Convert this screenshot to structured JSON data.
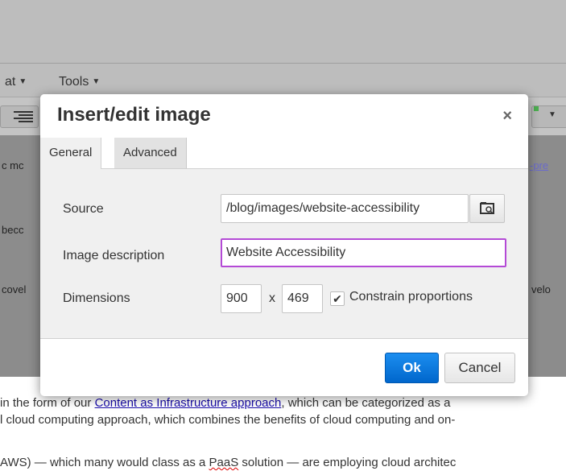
{
  "menubar": {
    "partial_menu": "at",
    "tools": "Tools"
  },
  "background": {
    "left_fragments": [
      "c mc",
      "becc",
      "covel"
    ],
    "right_link_fragment": "-pre",
    "right_fragment": "velo",
    "paragraph1_before": "in the form of our ",
    "paragraph1_link": "Content as Infrastructure approach",
    "paragraph1_after": ", which can be categorized as a",
    "paragraph2": "l cloud computing approach, which combines the benefits of cloud computing and on-",
    "paragraph3_before": "AWS) — which many would class as a ",
    "paragraph3_misspelled": "PaaS",
    "paragraph3_after": " solution — are employing cloud architec"
  },
  "dialog": {
    "title": "Insert/edit image",
    "close_symbol": "×",
    "tabs": [
      {
        "label": "General",
        "active": true
      },
      {
        "label": "Advanced",
        "active": false
      }
    ],
    "fields": {
      "source_label": "Source",
      "source_value": "/blog/images/website-accessibility",
      "description_label": "Image description",
      "description_value": "Website Accessibility",
      "dimensions_label": "Dimensions",
      "width_value": "900",
      "dimension_separator": "x",
      "height_value": "469",
      "constrain_label": "Constrain proportions",
      "constrain_checked": true
    },
    "buttons": {
      "ok": "Ok",
      "cancel": "Cancel"
    }
  },
  "colors": {
    "primary_button": "#0a78e0",
    "focus_border": "#b44ad6",
    "overlay": "#8c8c8c"
  }
}
